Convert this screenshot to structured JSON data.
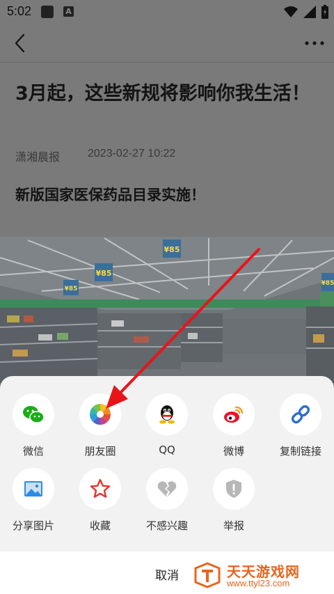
{
  "status_bar": {
    "time": "5:02",
    "badge": "A"
  },
  "article": {
    "title": "3月起，这些新规将影响你我生活！",
    "source": "潇湘晨报",
    "date": "2023-02-27 10:22",
    "subtitle": "新版国家医保药品目录实施！",
    "photo_signs": [
      "¥85",
      "¥85",
      "¥85",
      "¥85"
    ]
  },
  "share": {
    "row1": [
      {
        "label": "微信",
        "icon": "wechat-icon"
      },
      {
        "label": "朋友圈",
        "icon": "moments-icon"
      },
      {
        "label": "QQ",
        "icon": "qq-icon"
      },
      {
        "label": "微博",
        "icon": "weibo-icon"
      },
      {
        "label": "复制链接",
        "icon": "link-icon"
      }
    ],
    "row2": [
      {
        "label": "分享图片",
        "icon": "image-icon"
      },
      {
        "label": "收藏",
        "icon": "star-icon"
      },
      {
        "label": "不感兴趣",
        "icon": "broken-heart-icon"
      },
      {
        "label": "举报",
        "icon": "report-icon"
      }
    ],
    "cancel": "取消"
  },
  "watermark": {
    "name": "天天游戏网",
    "url": "www.ttyl23.com"
  },
  "colors": {
    "wechat": "#1aad19",
    "qq": "#111111",
    "weibo": "#e6162d",
    "link": "#2b6cd6",
    "star": "#e0342c",
    "watermark": "#e8641e",
    "arrow": "#e8141a"
  }
}
